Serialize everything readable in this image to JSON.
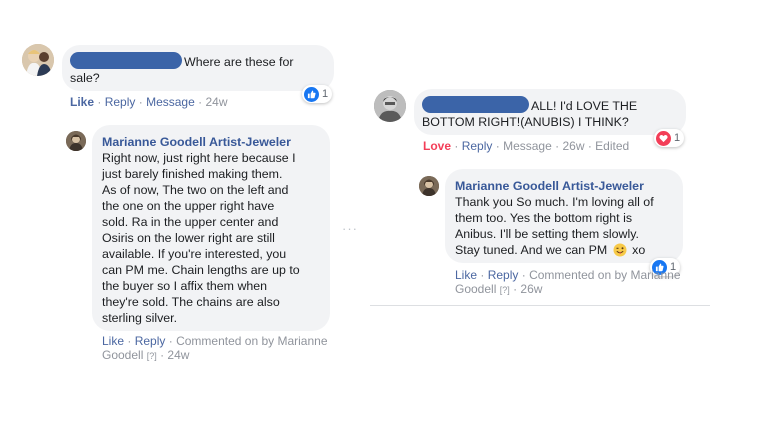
{
  "colors": {
    "link": "#4b67a1",
    "name": "#385898",
    "bubble": "#f2f3f5",
    "love": "#f33e58",
    "like": "#1877f2"
  },
  "left": {
    "comment": {
      "text": "Where are these for",
      "text_line2": "sale?",
      "reaction_count": "1",
      "reaction_icon": "thumbs-up-icon",
      "actions": {
        "like": "Like",
        "reply": "Reply",
        "message": "Message",
        "time": "24w"
      }
    },
    "reply": {
      "author": "Marianne Goodell Artist-Jeweler",
      "lines": [
        "Right now, just right here because I",
        "just barely finished making them.",
        "As of now, The two on the left and",
        "the one on the upper right have",
        "sold. Ra in the upper center and",
        "Osiris on the lower right are still",
        "available. If you're interested, you",
        "can PM me. Chain lengths are up to",
        "the buyer so I affix them when",
        "they're sold. The chains are also",
        "sterling silver."
      ],
      "actions": {
        "like": "Like",
        "reply": "Reply",
        "commented_on": "Commented on by Marianne",
        "commented_line2": "Goodell",
        "mark": "[?]",
        "time": "24w"
      }
    }
  },
  "more": "···",
  "right": {
    "comment": {
      "text": "ALL! I'd LOVE THE",
      "text_line2": "BOTTOM RIGHT!(ANUBIS) I THINK?",
      "reaction_count": "1",
      "reaction_icon": "heart-icon",
      "actions": {
        "love": "Love",
        "reply": "Reply",
        "message": "Message",
        "time": "26w",
        "edited": "Edited"
      }
    },
    "reply": {
      "author": "Marianne Goodell Artist-Jeweler",
      "lines": [
        "Thank you So much. I'm loving all of",
        "them too. Yes the bottom right is",
        "Anibus. I'll be setting them slowly.",
        "Stay tuned. And we can PM"
      ],
      "last_suffix": "xo",
      "emoji": "winking-tongue-emoji",
      "reaction_count": "1",
      "reaction_icon": "thumbs-up-icon",
      "actions": {
        "like": "Like",
        "reply": "Reply",
        "commented_on": "Commented on by Marianne",
        "commented_line2": "Goodell",
        "mark": "[?]",
        "time": "26w"
      }
    }
  }
}
